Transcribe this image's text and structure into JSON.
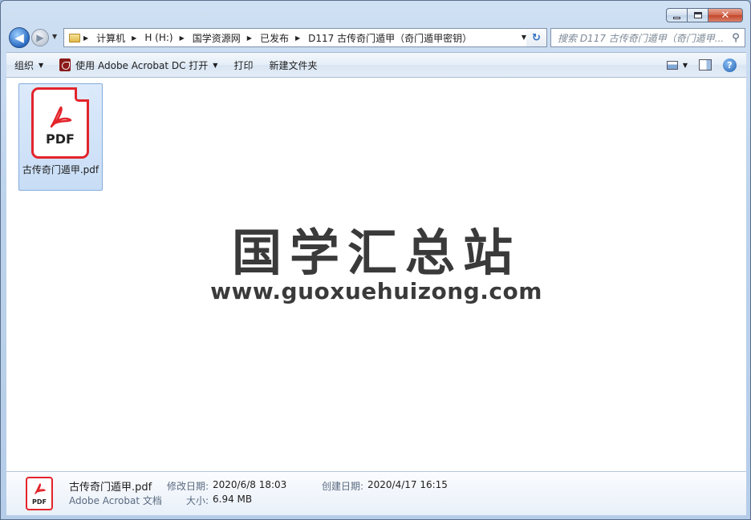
{
  "window": {
    "minimize_glyph": "",
    "maximize_glyph": "",
    "close_glyph": "✕"
  },
  "nav": {
    "back_glyph": "◀",
    "forward_glyph": "▶",
    "breadcrumbs": [
      "计算机",
      "H (H:)",
      "国学资源网",
      "已发布",
      "D117 古传奇门遁甲（奇门遁甲密钥）"
    ],
    "search_placeholder": "搜索 D117 古传奇门遁甲（奇门遁甲...",
    "refresh_glyph": "↻",
    "search_icon": "⚲"
  },
  "toolbar": {
    "organize": "组织",
    "open_with": "使用 Adobe Acrobat DC 打开",
    "print": "打印",
    "new_folder": "新建文件夹",
    "help_glyph": "?"
  },
  "content": {
    "file": {
      "icon_label": "PDF",
      "name": "古传奇门遁甲.pdf"
    },
    "watermark": {
      "title": "国学汇总站",
      "url": "www.guoxuehuizong.com"
    }
  },
  "details": {
    "icon_label": "PDF",
    "filename": "古传奇门遁甲.pdf",
    "type": "Adobe Acrobat 文档",
    "modified_label": "修改日期:",
    "modified_value": "2020/6/8 18:03",
    "size_label": "大小:",
    "size_value": "6.94 MB",
    "created_label": "创建日期:",
    "created_value": "2020/4/17 16:15"
  },
  "colors": {
    "accent": "#e3242b",
    "selection": "#cce1f8"
  }
}
